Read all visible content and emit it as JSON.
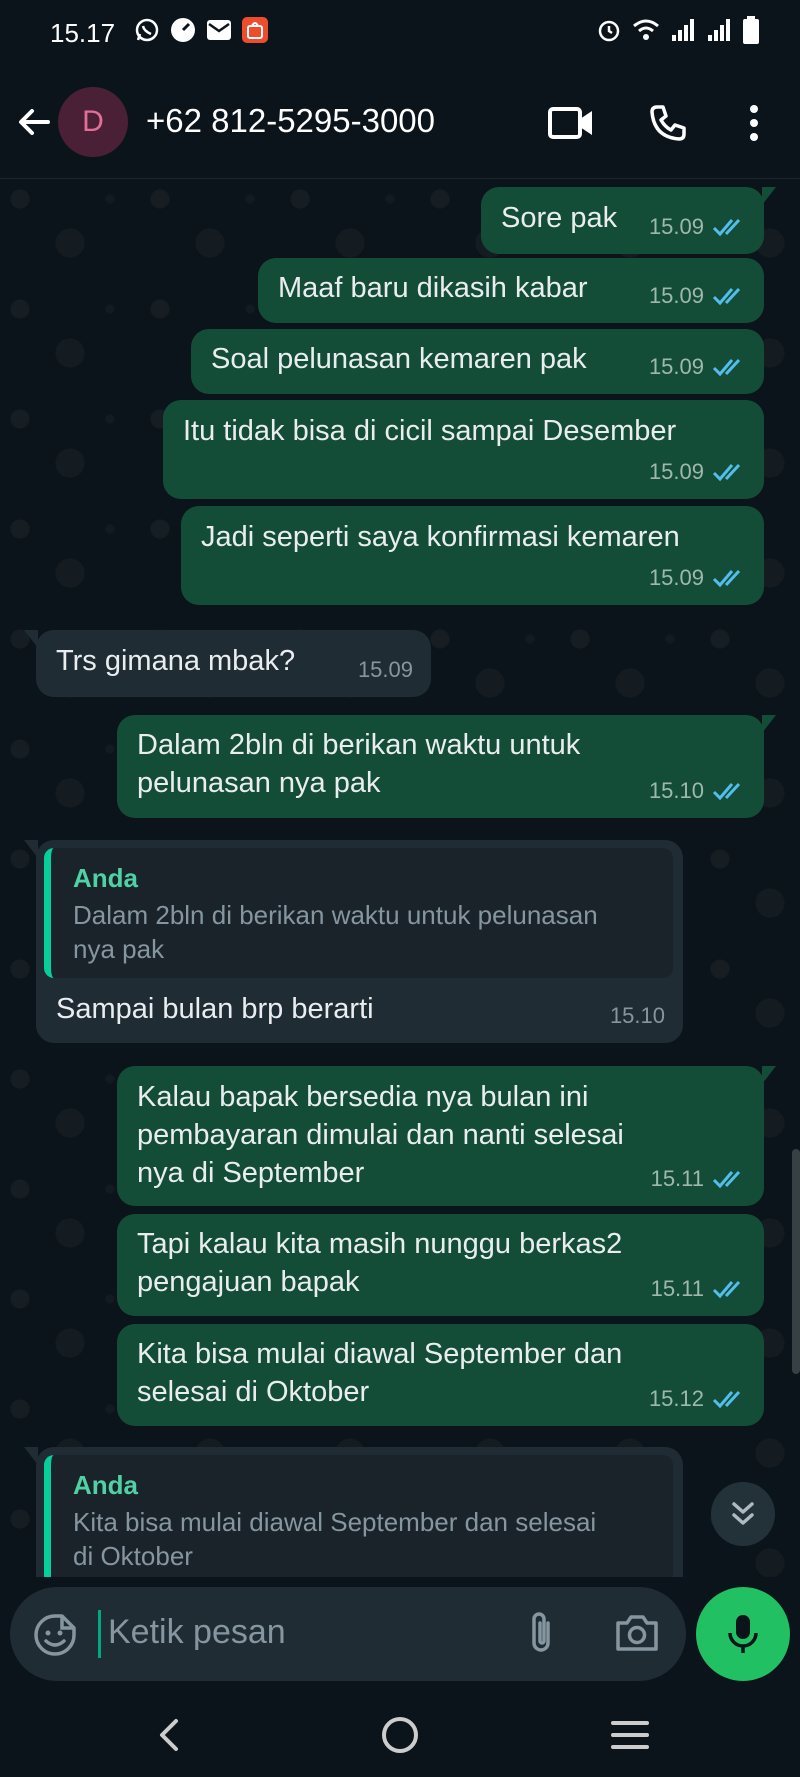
{
  "status_bar": {
    "time": "15.17",
    "app_icons": [
      "whatsapp-icon",
      "speedometer-icon",
      "gmail-icon",
      "shopee-icon"
    ],
    "system_icons": [
      "alarm-icon",
      "wifi-icon",
      "signal-icon",
      "signal-icon",
      "battery-icon"
    ]
  },
  "header": {
    "avatar_letter": "D",
    "contact": "+62 812-5295-3000",
    "actions": [
      "video-call-icon",
      "voice-call-icon",
      "more-options-icon"
    ]
  },
  "messages": [
    {
      "dir": "out",
      "text": "Sore pak",
      "time": "15.09",
      "status": "read"
    },
    {
      "dir": "out",
      "text": "Maaf baru dikasih kabar",
      "time": "15.09",
      "status": "read"
    },
    {
      "dir": "out",
      "text": "Soal pelunasan kemaren pak",
      "time": "15.09",
      "status": "read"
    },
    {
      "dir": "out",
      "text": "Itu tidak bisa di cicil sampai Desember",
      "time": "15.09",
      "status": "read"
    },
    {
      "dir": "out",
      "text": "Jadi seperti saya konfirmasi kemaren",
      "time": "15.09",
      "status": "read"
    },
    {
      "dir": "in",
      "text": "Trs gimana mbak?",
      "time": "15.09"
    },
    {
      "dir": "out",
      "text": "Dalam 2bln di berikan waktu untuk\npelunasan nya pak",
      "time": "15.10",
      "status": "read"
    },
    {
      "dir": "in",
      "quote_author": "Anda",
      "quote_text": "Dalam 2bln di berikan waktu untuk pelunasan\nnya pak",
      "text": "Sampai bulan brp berarti",
      "time": "15.10"
    },
    {
      "dir": "out",
      "text": "Kalau bapak bersedia nya bulan ini\npembayaran dimulai dan nanti selesai\nnya di September",
      "time": "15.11",
      "status": "read"
    },
    {
      "dir": "out",
      "text": "Tapi kalau kita masih nunggu berkas2\npengajuan bapak",
      "time": "15.11",
      "status": "read"
    },
    {
      "dir": "out",
      "text": "Kita bisa mulai diawal September dan\nselesai di Oktober",
      "time": "15.12",
      "status": "read"
    },
    {
      "dir": "in",
      "quote_author": "Anda",
      "quote_text": "Kita bisa mulai diawal September dan selesai\ndi Oktober",
      "text": "",
      "time": ""
    }
  ],
  "composer": {
    "placeholder": "Ketik pesan"
  },
  "colors": {
    "background": "#0b141a",
    "outgoing_bubble": "#144d37",
    "incoming_bubble": "#202c33",
    "read_tick": "#53bdeb",
    "accent": "#21c063"
  }
}
